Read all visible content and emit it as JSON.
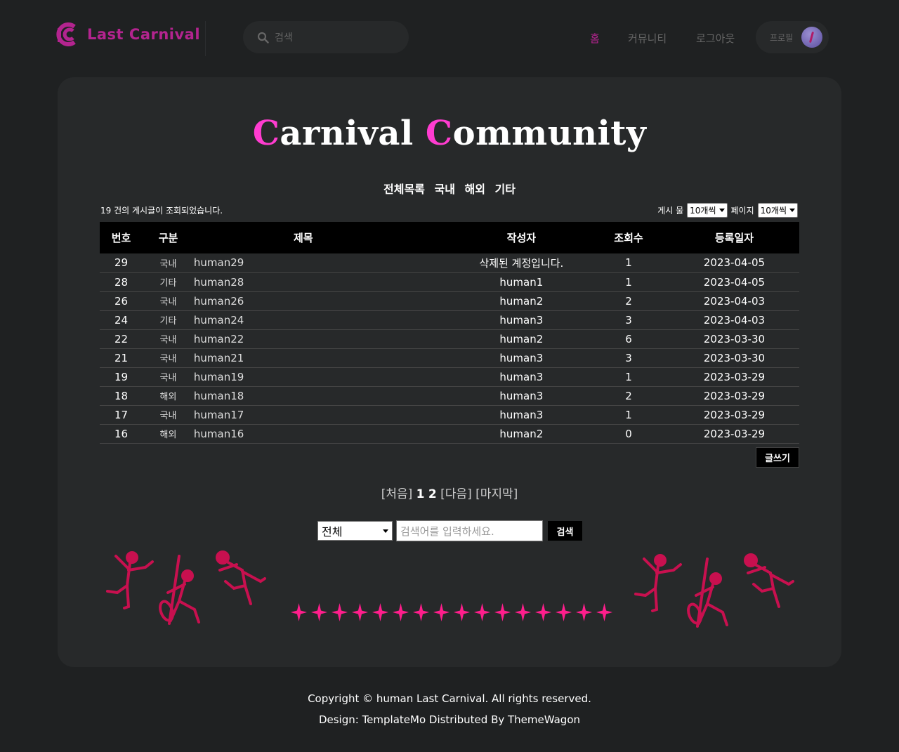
{
  "header": {
    "logo_text": "Last Carnival",
    "search_placeholder": "검색",
    "nav": [
      "홈",
      "커뮤니티",
      "로그아웃"
    ],
    "profile_label": "프로필",
    "brand_color": "#b3248f"
  },
  "title": {
    "part1_cap": "C",
    "part1_rest": "arnival ",
    "part2_cap": "C",
    "part2_rest": "ommunity"
  },
  "categories": [
    "전체목록",
    "국내",
    "해외",
    "기타"
  ],
  "count_info": "19 건의 게시글이 조회되었습니다.",
  "per_page": {
    "posts_label": "게시 물",
    "posts_value": "10개씩",
    "pages_label": "페이지",
    "pages_value": "10개씩"
  },
  "table": {
    "headers": [
      "번호",
      "구분",
      "제목",
      "작성자",
      "조회수",
      "등록일자"
    ],
    "rows": [
      [
        "29",
        "국내",
        "human29",
        "삭제된 계정입니다.",
        "1",
        "2023-04-05"
      ],
      [
        "28",
        "기타",
        "human28",
        "human1",
        "1",
        "2023-04-05"
      ],
      [
        "26",
        "국내",
        "human26",
        "human2",
        "2",
        "2023-04-03"
      ],
      [
        "24",
        "기타",
        "human24",
        "human3",
        "3",
        "2023-04-03"
      ],
      [
        "22",
        "국내",
        "human22",
        "human2",
        "6",
        "2023-03-30"
      ],
      [
        "21",
        "국내",
        "human21",
        "human3",
        "3",
        "2023-03-30"
      ],
      [
        "19",
        "국내",
        "human19",
        "human3",
        "1",
        "2023-03-29"
      ],
      [
        "18",
        "해외",
        "human18",
        "human3",
        "2",
        "2023-03-29"
      ],
      [
        "17",
        "국내",
        "human17",
        "human3",
        "1",
        "2023-03-29"
      ],
      [
        "16",
        "해외",
        "human16",
        "human2",
        "0",
        "2023-03-29"
      ]
    ]
  },
  "write_button": "글쓰기",
  "pager": {
    "first": "[처음]",
    "pages": [
      "1",
      "2"
    ],
    "next": "[다음]",
    "last": "[마지막]"
  },
  "search": {
    "field": "전체",
    "placeholder": "검색어를 입력하세요.",
    "button": "검색"
  },
  "footer": {
    "copyright": "Copyright © human Last Carnival. All rights reserved.",
    "design": "Design: TemplateMo Distributed By ThemeWagon"
  },
  "colors": {
    "accent_pink": "#ff3cd0",
    "dancer": "#c8104f",
    "star": "#ff1e8c"
  }
}
